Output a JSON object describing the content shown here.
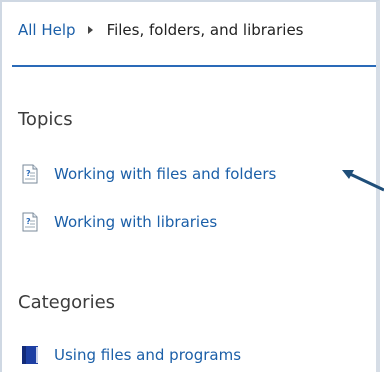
{
  "breadcrumb": {
    "root": "All Help",
    "current": "Files, folders, and libraries"
  },
  "topics": {
    "heading": "Topics",
    "items": [
      {
        "label": "Working with files and folders",
        "icon": "help-document-icon"
      },
      {
        "label": "Working with libraries",
        "icon": "help-document-icon"
      }
    ]
  },
  "categories": {
    "heading": "Categories",
    "items": [
      {
        "label": "Using files and programs",
        "icon": "help-book-icon"
      }
    ]
  },
  "colors": {
    "link": "#1b5fa8",
    "rule": "#2a6ab8",
    "callout": "#1f4e79"
  }
}
